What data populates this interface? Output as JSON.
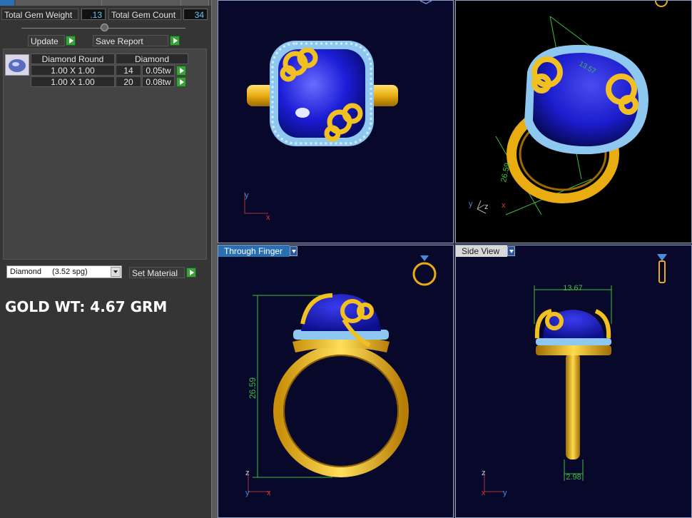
{
  "left_panel": {
    "total_gem_weight_label": "Total Gem Weight",
    "total_gem_weight_value": ".13",
    "total_gem_count_label": "Total Gem Count",
    "total_gem_count_value": "34",
    "update_label": "Update",
    "save_report_label": "Save Report",
    "table": {
      "headers": [
        "Diamond Round",
        "Diamond"
      ],
      "rows": [
        {
          "size": "1.00 X 1.00",
          "count": "14",
          "weight": "0.05tw"
        },
        {
          "size": "1.00 X 1.00",
          "count": "20",
          "weight": "0.08tw"
        }
      ]
    },
    "material_select": {
      "value": "Diamond",
      "detail": "(3.52 spg)"
    },
    "set_material_label": "Set Material",
    "gold_weight_text": "GOLD WT: 4.67 GRM"
  },
  "viewports": {
    "bottom_left": {
      "tab_label": "Through Finger",
      "dimension_label": "26.59"
    },
    "bottom_right": {
      "tab_label": "Side View",
      "width_label": "13.67",
      "shank_label": "2.98"
    },
    "top_right": {
      "dimension_label": "26.59",
      "top_dim_label": "13.57"
    },
    "axis_labels": {
      "x": "x",
      "y": "y",
      "z": "z"
    }
  },
  "colors": {
    "viewport_bg": "#07082a",
    "gold": "#f2c021",
    "gem": "#1a1ad8",
    "halo": "#88c8f0",
    "dimension": "#3fbf3f",
    "accent_button": "#3aa13a"
  }
}
